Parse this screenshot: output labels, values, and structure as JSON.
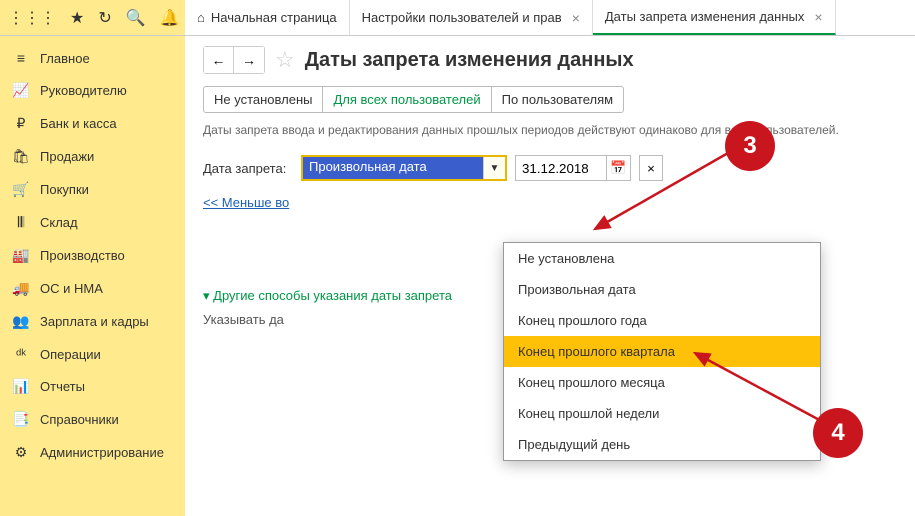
{
  "topIcons": [
    "apps",
    "star",
    "clock",
    "search",
    "bell"
  ],
  "tabs": [
    {
      "label": "Начальная страница",
      "hasHome": true,
      "closable": false,
      "active": false
    },
    {
      "label": "Настройки пользователей и прав",
      "closable": true,
      "active": false
    },
    {
      "label": "Даты запрета изменения данных",
      "closable": true,
      "active": true
    }
  ],
  "sidebar": [
    {
      "label": "Главное",
      "icon": "≡"
    },
    {
      "label": "Руководителю",
      "icon": "📈"
    },
    {
      "label": "Банк и касса",
      "icon": "₽"
    },
    {
      "label": "Продажи",
      "icon": "🛍"
    },
    {
      "label": "Покупки",
      "icon": "🛒"
    },
    {
      "label": "Склад",
      "icon": "𝄃𝄃"
    },
    {
      "label": "Производство",
      "icon": "🏭"
    },
    {
      "label": "ОС и НМА",
      "icon": "🚚"
    },
    {
      "label": "Зарплата и кадры",
      "icon": "👥"
    },
    {
      "label": "Операции",
      "icon": "ᵈᵏ"
    },
    {
      "label": "Отчеты",
      "icon": "📊"
    },
    {
      "label": "Справочники",
      "icon": "📑"
    },
    {
      "label": "Администрирование",
      "icon": "⚙"
    }
  ],
  "page": {
    "title": "Даты запрета изменения данных",
    "modes": [
      "Не установлены",
      "Для всех пользователей",
      "По пользователям"
    ],
    "modeActive": 1,
    "desc": "Даты запрета ввода и редактирования данных прошлых периодов действуют одинаково для всех пользователей.",
    "fieldLabel": "Дата запрета:",
    "comboValue": "Произвольная дата",
    "dateValue": "31.12.2018",
    "lessLink": "<< Меньше во",
    "otherWays": "Другие способы указания даты запрета",
    "specify": "Указывать да"
  },
  "dropdown": {
    "items": [
      "Не установлена",
      "Произвольная дата",
      "Конец прошлого года",
      "Конец прошлого квартала",
      "Конец прошлого месяца",
      "Конец прошлой недели",
      "Предыдущий день"
    ],
    "selected": 3
  },
  "badges": {
    "b3": "3",
    "b4": "4"
  }
}
